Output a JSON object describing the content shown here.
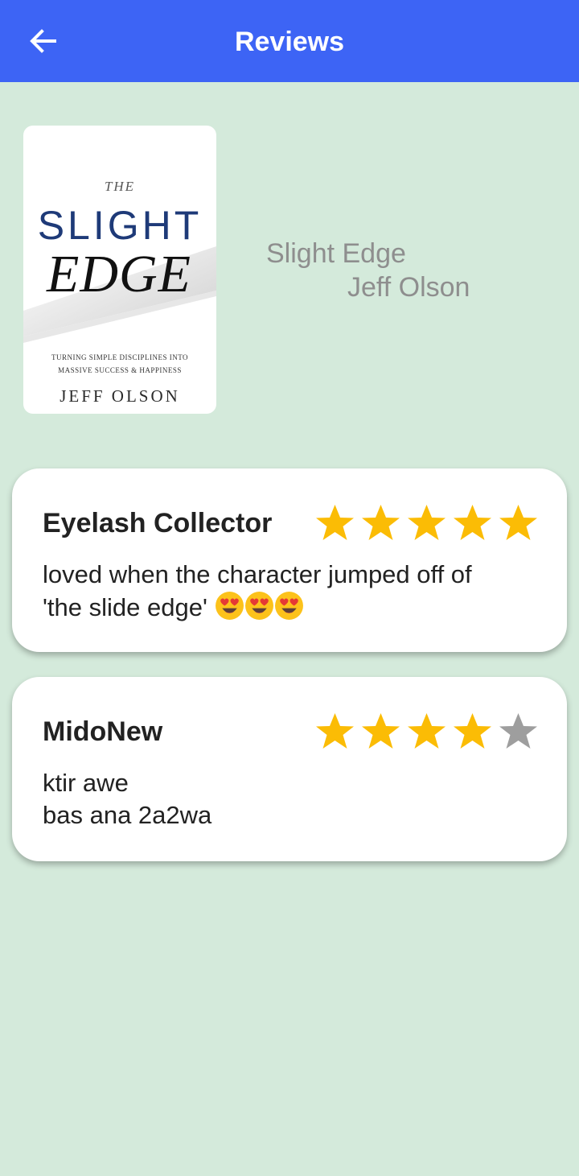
{
  "appbar": {
    "title": "Reviews",
    "back_icon": "arrow-left-icon",
    "color": "#3d64f5"
  },
  "book": {
    "title": "Slight Edge",
    "author": "Jeff Olson",
    "cover": {
      "line_the": "THE",
      "line_slight": "SLIGHT",
      "line_edge": "EDGE",
      "subtitle_1": "TURNING SIMPLE DISCIPLINES INTO",
      "subtitle_2": "MASSIVE SUCCESS & HAPPINESS",
      "author": "JEFF OLSON"
    }
  },
  "reviews": [
    {
      "name": "Eyelash Collector",
      "rating": 5,
      "max_rating": 5,
      "text": "loved when the character jumped off of\n'the slide edge' ",
      "emojis": [
        "heart-eyes-emoji",
        "heart-eyes-emoji",
        "heart-eyes-emoji"
      ]
    },
    {
      "name": "MidoNew",
      "rating": 4,
      "max_rating": 5,
      "text": "ktir awe\nbas ana 2a2wa",
      "emojis": []
    }
  ],
  "colors": {
    "background": "#d4eadb",
    "star_filled": "#fbbc05",
    "star_empty": "#9e9e9e",
    "book_text": "#8e8e8e"
  }
}
